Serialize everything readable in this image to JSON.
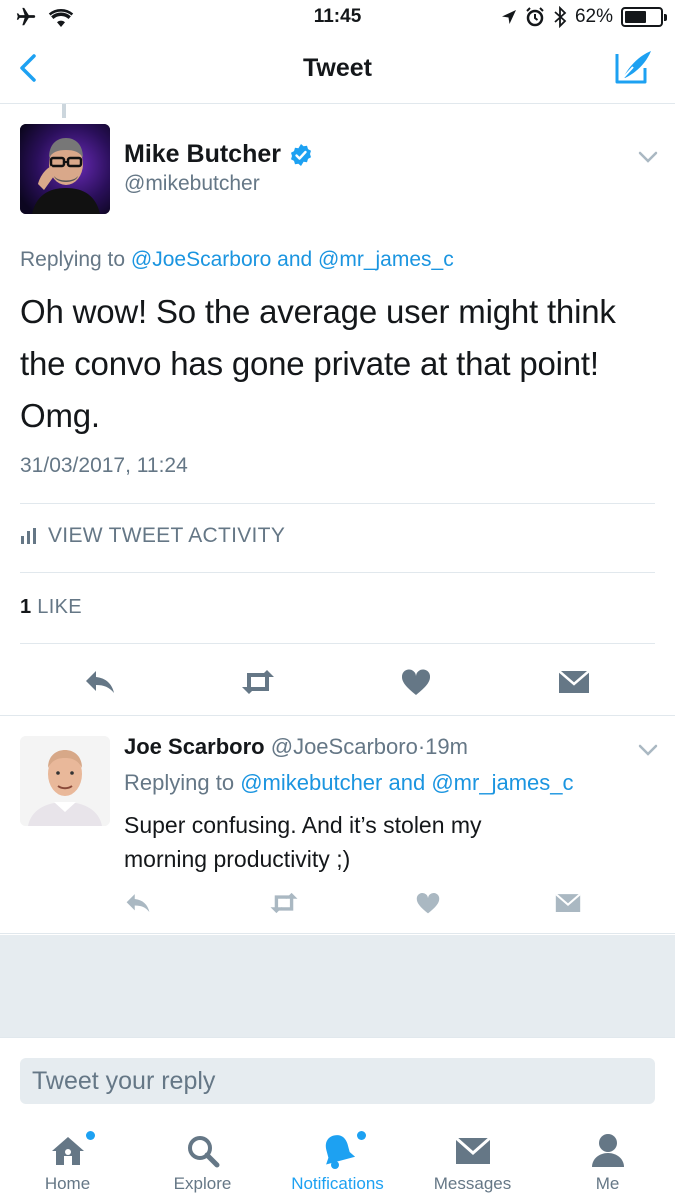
{
  "status_bar": {
    "time": "11:45",
    "battery_percent": "62%",
    "battery_level": 0.62,
    "icons": [
      "airplane-icon",
      "wifi-icon",
      "location-arrow-icon",
      "alarm-icon",
      "bluetooth-icon",
      "battery-icon"
    ]
  },
  "nav": {
    "title": "Tweet",
    "back_icon": "chevron-left-icon",
    "compose_icon": "compose-tweet-icon"
  },
  "main_tweet": {
    "author_name": "Mike Butcher",
    "author_handle": "@mikebutcher",
    "verified": true,
    "replying_prefix": "Replying to",
    "replying_user1": "@JoeScarboro",
    "replying_and": "and",
    "replying_user2": "@mr_james_c",
    "text_line1": "Oh wow! So the average user might think",
    "text_line2": "the convo has gone private at that point!",
    "text_line3": "Omg.",
    "timestamp": "31/03/2017, 11:24",
    "activity_label": "VIEW TWEET ACTIVITY",
    "likes_count": "1",
    "likes_label": "LIKE"
  },
  "reply_tweet": {
    "author_name": "Joe Scarboro",
    "author_handle": "@JoeScarboro",
    "separator": "·",
    "age": "19m",
    "replying_prefix": "Replying to",
    "replying_user1": "@mikebutcher",
    "replying_and": "and",
    "replying_user2": "@mr_james_c",
    "text_line1": "Super confusing. And it’s stolen my",
    "text_line2": "morning productivity ;)"
  },
  "composer": {
    "placeholder": "Tweet your reply"
  },
  "tabs": [
    {
      "label": "Home",
      "icon": "home-icon",
      "active": false,
      "dot": true
    },
    {
      "label": "Explore",
      "icon": "search-icon",
      "active": false,
      "dot": false
    },
    {
      "label": "Notifications",
      "icon": "bell-icon",
      "active": true,
      "dot": true
    },
    {
      "label": "Messages",
      "icon": "envelope-icon",
      "active": false,
      "dot": false
    },
    {
      "label": "Me",
      "icon": "person-icon",
      "active": false,
      "dot": false
    }
  ],
  "colors": {
    "accent": "#1da1f2",
    "link": "#1b95e0",
    "secondary_text": "#657786",
    "icon_gray": "#657786",
    "background_gray": "#e6ecf0"
  }
}
